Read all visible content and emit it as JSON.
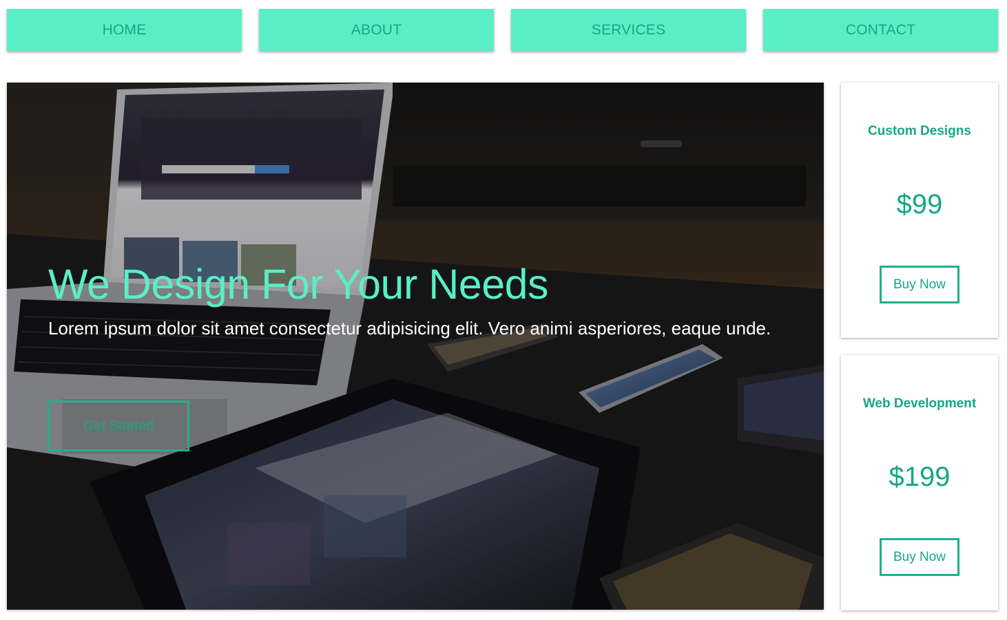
{
  "nav": {
    "items": [
      {
        "label": "HOME"
      },
      {
        "label": "ABOUT"
      },
      {
        "label": "SERVICES"
      },
      {
        "label": "CONTACT"
      }
    ]
  },
  "hero": {
    "title": "We Design For Your Needs",
    "text": "Lorem ipsum dolor sit amet consectetur adipisicing elit. Vero animi asperiores, eaque unde.",
    "button_label": "Get Started",
    "image_description_icon": "laptop-devices-photo"
  },
  "cards": [
    {
      "title": "Custom Designs",
      "price": "$99",
      "button_label": "Buy Now"
    },
    {
      "title": "Web Development",
      "price": "$199",
      "button_label": "Buy Now"
    }
  ],
  "colors": {
    "accent": "#58efc7",
    "accent_dark": "#16a784",
    "border": "#1fb08c",
    "hero_overlay": "#1a1a1c"
  }
}
